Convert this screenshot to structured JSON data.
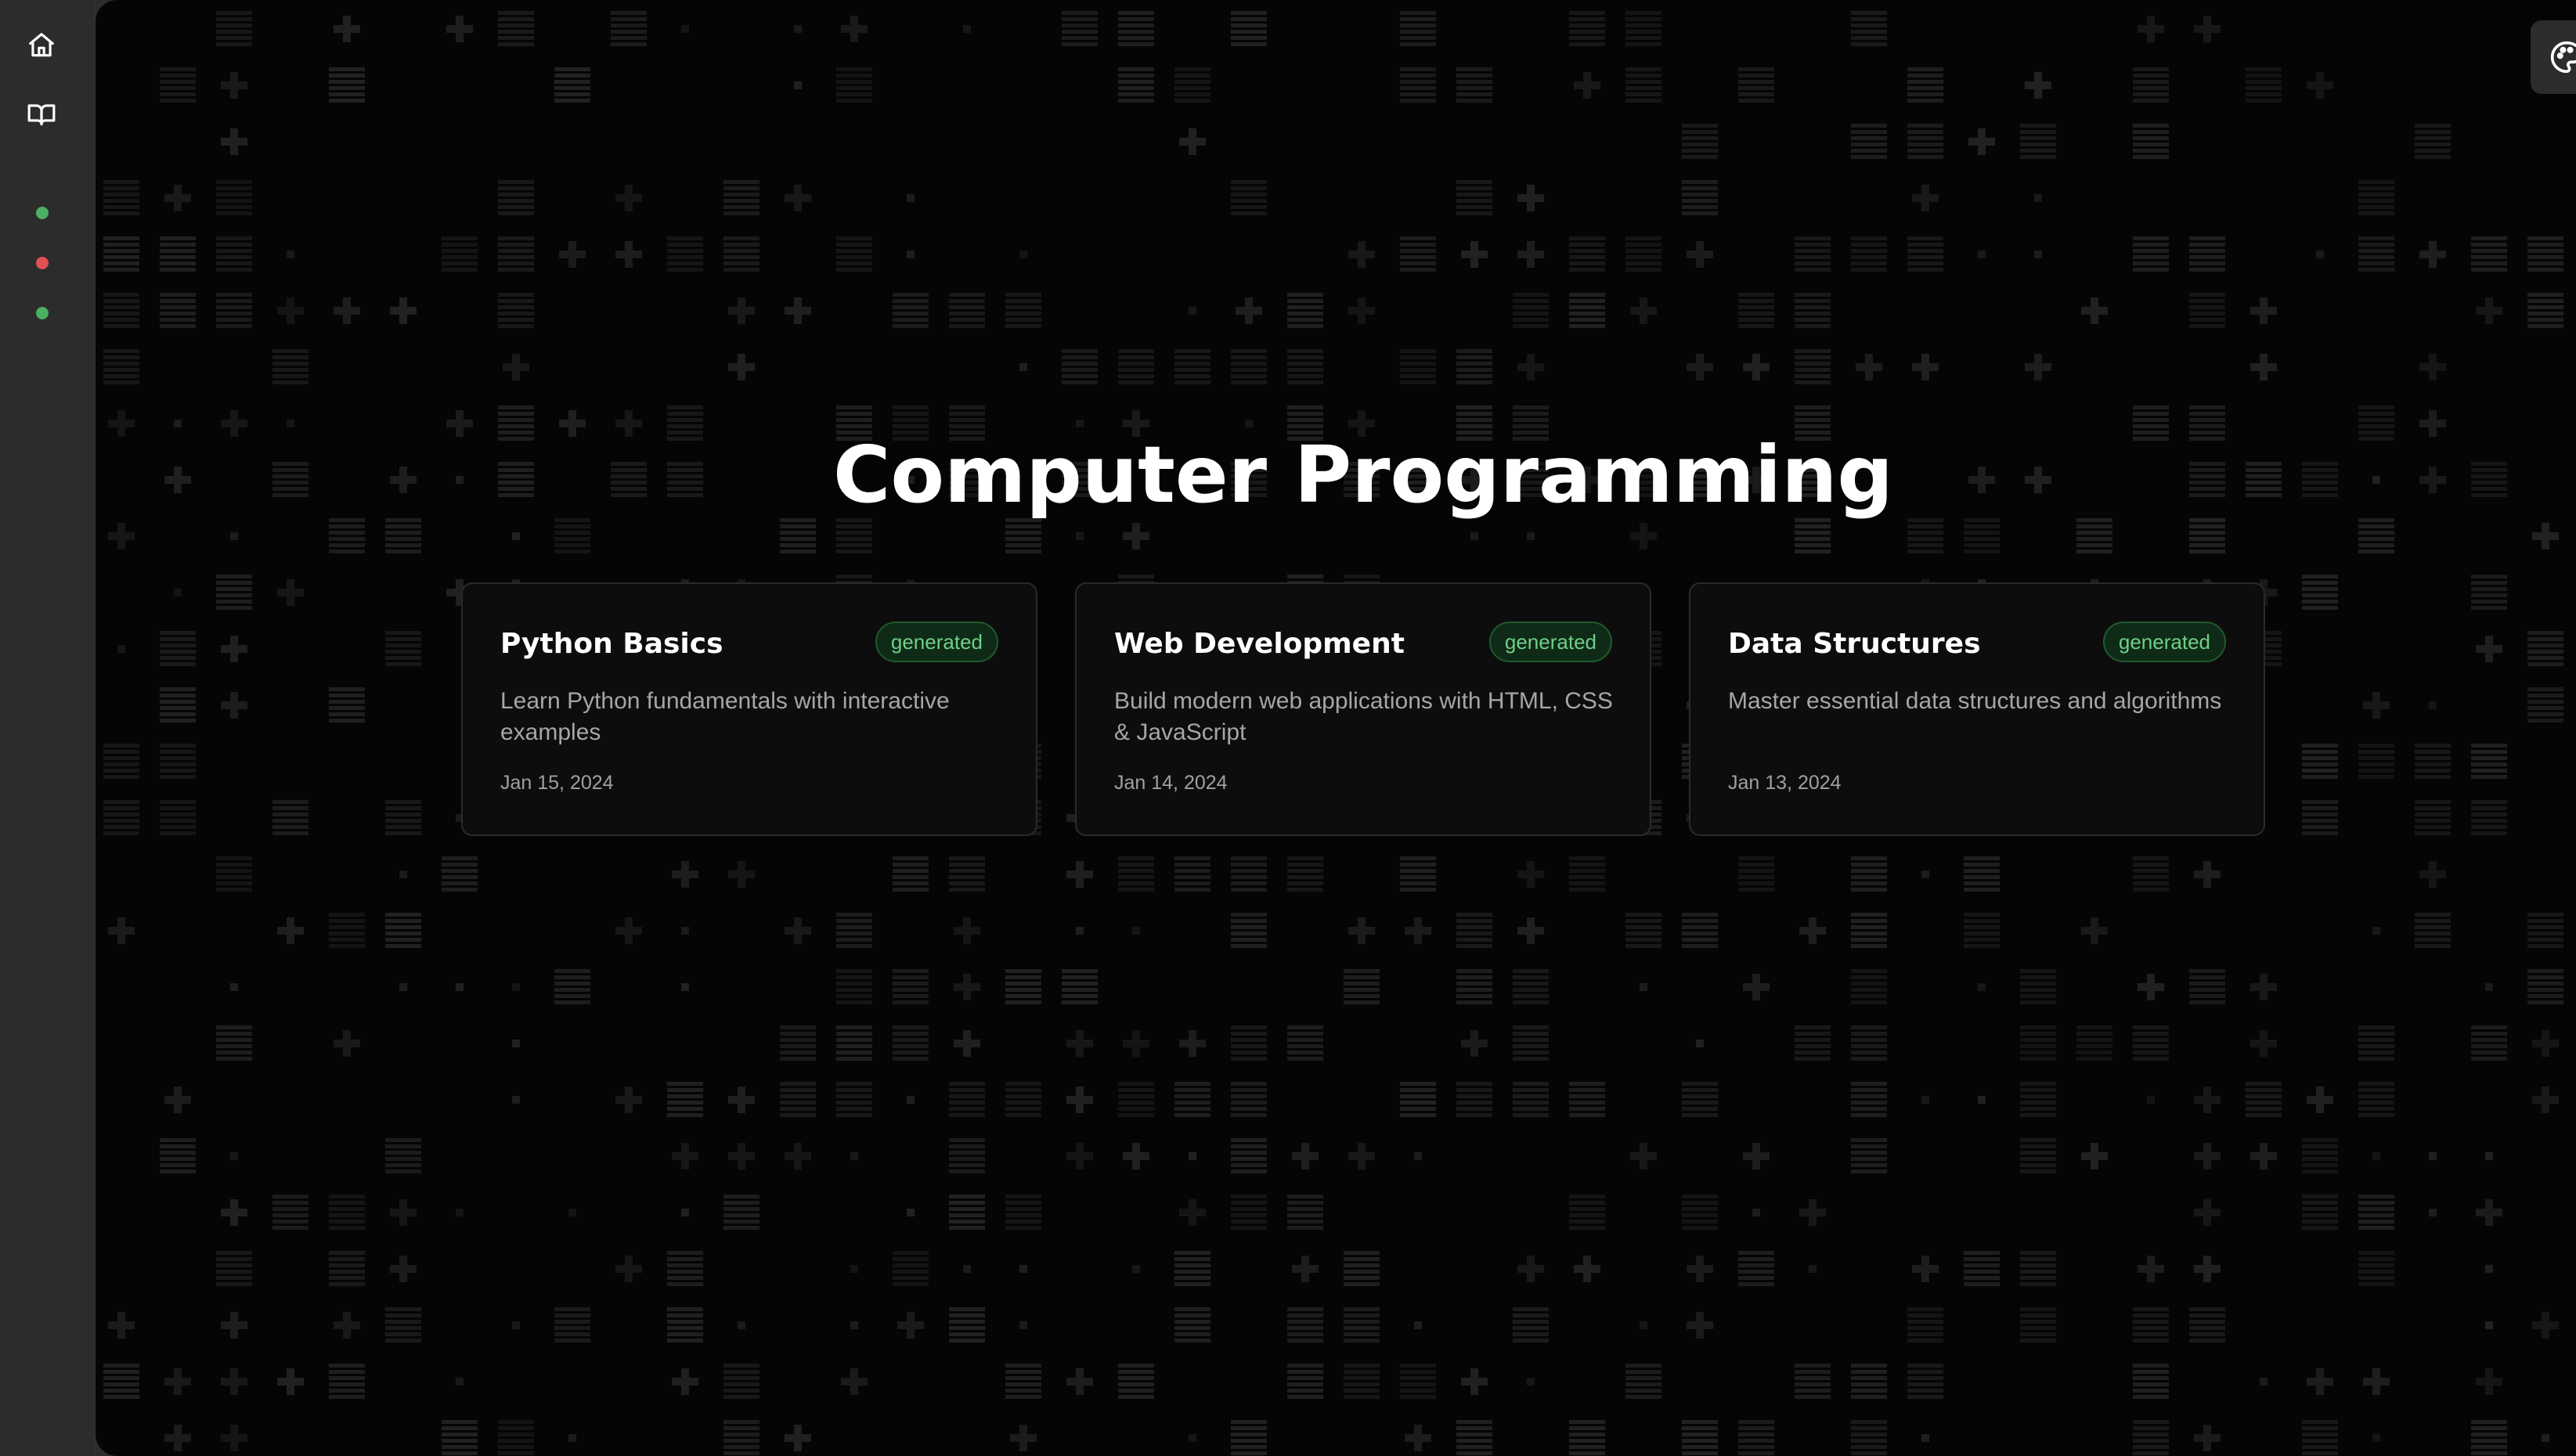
{
  "sidebar": {
    "icons": [
      "home-icon",
      "book-icon"
    ],
    "status_colors": [
      "#4caf63",
      "#e05252",
      "#4caf63"
    ]
  },
  "main": {
    "title": "Computer Programming",
    "cards": [
      {
        "title": "Python Basics",
        "badge": "generated",
        "description": "Learn Python fundamentals with interactive examples",
        "date": "Jan 15, 2024"
      },
      {
        "title": "Web Development",
        "badge": "generated",
        "description": "Build modern web applications with HTML, CSS & JavaScript",
        "date": "Jan 14, 2024"
      },
      {
        "title": "Data Structures",
        "badge": "generated",
        "description": "Master essential data structures and algorithms",
        "date": "Jan 13, 2024"
      }
    ]
  },
  "theme_toggle": {
    "icon": "palette-icon"
  },
  "colors": {
    "accent": "#6fcf86",
    "background": "#050505",
    "sidebar": "#2c2c2c"
  }
}
